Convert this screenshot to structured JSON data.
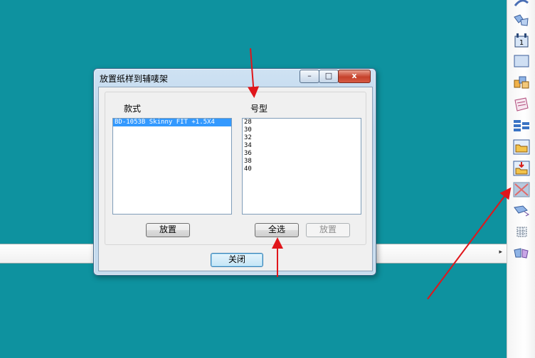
{
  "dialog": {
    "title": "放置纸样到辅唛架",
    "close_glyph": "x",
    "min_glyph": "–",
    "max_glyph": "□"
  },
  "styles": {
    "label": "款式",
    "items": [
      "BD-1053B  Skinny FIT +1.5X4"
    ],
    "place_button": "放置"
  },
  "sizes": {
    "label": "号型",
    "items": [
      "28",
      "30",
      "32",
      "34",
      "36",
      "38",
      "40"
    ],
    "select_all_button": "全选",
    "place_button": "放置"
  },
  "footer": {
    "close_button": "关闭"
  },
  "bottom_strip": {
    "arrow_glyph": "▸"
  },
  "colors": {
    "background": "#0e929f",
    "annotation": "#e0161b",
    "selection": "#3399ff"
  },
  "toolbar_icons": [
    "curve-tool-icon",
    "pattern-pieces-icon",
    "page-number-icon",
    "rectangle-icon",
    "multi-piece-icon",
    "notebook-icon",
    "layers-icon",
    "open-folder-icon",
    "import-folder-icon",
    "cancel-cross-icon",
    "tilt-piece-icon",
    "grid-icon",
    "split-piece-icon"
  ]
}
